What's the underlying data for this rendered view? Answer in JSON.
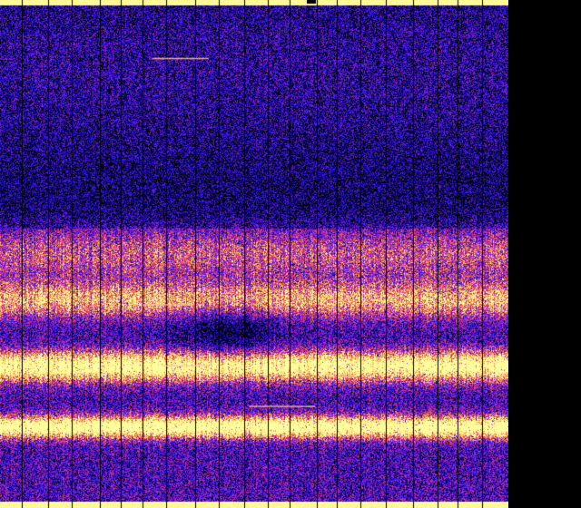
{
  "spectrogram": {
    "palette": [
      "#000000",
      "#0a0050",
      "#1a10c8",
      "#3a18f0",
      "#8a20d8",
      "#d02a90",
      "#f05a50",
      "#ffb04a",
      "#fff08a",
      "#ffffa0"
    ],
    "background": "#000000",
    "column_line_color": "#000000",
    "edge_glow_color": "#fff7a0",
    "bands": [
      {
        "center": 0.59,
        "strength": 0.55,
        "width": 0.035
      },
      {
        "center": 0.72,
        "strength": 0.85,
        "width": 0.03
      },
      {
        "center": 0.84,
        "strength": 0.9,
        "width": 0.022
      },
      {
        "center": 0.5,
        "strength": 0.35,
        "width": 0.05
      }
    ],
    "column_dividers": 20,
    "tone_marks": [
      {
        "row": 0.115,
        "from": 0.3,
        "to": 0.41
      },
      {
        "row": 0.6,
        "from": 0.28,
        "to": 0.38
      },
      {
        "row": 0.72,
        "from": 0.32,
        "to": 0.41
      },
      {
        "row": 0.8,
        "from": 0.49,
        "to": 0.62
      }
    ]
  }
}
